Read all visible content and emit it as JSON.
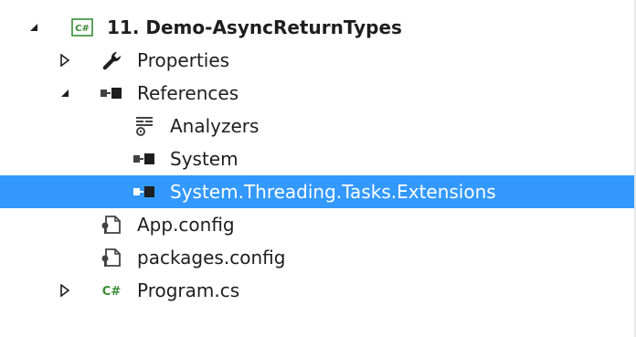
{
  "tree": {
    "project": {
      "label": "11. Demo-AsyncReturnTypes",
      "icon": "csharp-project-icon",
      "expanded": true
    },
    "items": [
      {
        "label": "Properties",
        "icon": "wrench-icon",
        "expander": "collapsed"
      },
      {
        "label": "References",
        "icon": "references-icon",
        "expander": "expanded"
      },
      {
        "label": "Analyzers",
        "icon": "analyzers-icon",
        "expander": "none"
      },
      {
        "label": "System",
        "icon": "reference-icon",
        "expander": "none"
      },
      {
        "label": "System.Threading.Tasks.Extensions",
        "icon": "reference-icon",
        "expander": "none",
        "selected": true
      },
      {
        "label": "App.config",
        "icon": "config-file-icon",
        "expander": "none"
      },
      {
        "label": "packages.config",
        "icon": "config-file-icon",
        "expander": "none"
      },
      {
        "label": "Program.cs",
        "icon": "csharp-file-icon",
        "expander": "collapsed"
      }
    ]
  },
  "colors": {
    "selection": "#3399ff",
    "csharp_green": "#388a34",
    "icon_dark": "#424242"
  }
}
